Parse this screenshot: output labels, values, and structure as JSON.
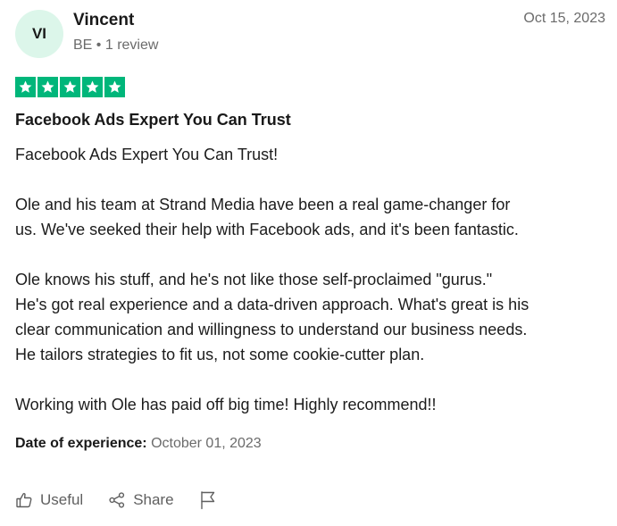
{
  "reviewer": {
    "initials": "VI",
    "name": "Vincent",
    "country": "BE",
    "separator": "•",
    "review_count": "1 review",
    "avatar_color": "#dcf6ea"
  },
  "review": {
    "date": "Oct 15, 2023",
    "rating": 5,
    "star_color": "#00b67a",
    "title": "Facebook Ads Expert You Can Trust",
    "paragraphs": [
      "Facebook Ads Expert You Can Trust!",
      "Ole and his team at Strand Media have been a real game-changer for\nus. We've seeked their help with Facebook ads, and it's been fantastic.",
      "Ole knows his stuff, and he's not like those self-proclaimed \"gurus.\"\nHe's got real experience and a data-driven approach. What's great is his\nclear communication and willingness to understand our business needs.\nHe tailors strategies to fit us, not some cookie-cutter plan.",
      "Working with Ole has paid off big time! Highly recommend!!"
    ],
    "experience_label": "Date of experience:",
    "experience_date": "October 01, 2023"
  },
  "actions": {
    "useful_label": "Useful",
    "share_label": "Share",
    "icons": [
      "thumbs-up-icon",
      "share-icon",
      "flag-icon"
    ]
  }
}
